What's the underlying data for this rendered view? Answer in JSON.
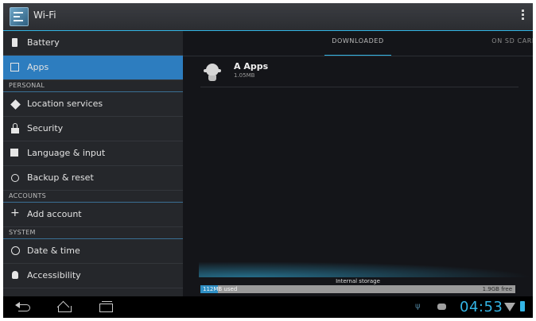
{
  "action_bar": {
    "title": "Wi-Fi"
  },
  "sidebar": {
    "items": [
      {
        "type": "item",
        "label": "Battery",
        "icon": "battery-icon",
        "selected": false
      },
      {
        "type": "item",
        "label": "Apps",
        "icon": "apps-icon",
        "selected": true
      },
      {
        "type": "header",
        "label": "PERSONAL"
      },
      {
        "type": "item",
        "label": "Location services",
        "icon": "location-icon",
        "selected": false
      },
      {
        "type": "item",
        "label": "Security",
        "icon": "lock-icon",
        "selected": false
      },
      {
        "type": "item",
        "label": "Language & input",
        "icon": "language-icon",
        "selected": false
      },
      {
        "type": "item",
        "label": "Backup & reset",
        "icon": "backup-icon",
        "selected": false
      },
      {
        "type": "header",
        "label": "ACCOUNTS"
      },
      {
        "type": "item",
        "label": "Add account",
        "icon": "plus-icon",
        "selected": false
      },
      {
        "type": "header",
        "label": "SYSTEM"
      },
      {
        "type": "item",
        "label": "Date & time",
        "icon": "clock-icon",
        "selected": false
      },
      {
        "type": "item",
        "label": "Accessibility",
        "icon": "accessibility-icon",
        "selected": false
      }
    ]
  },
  "tabs": {
    "downloaded": "DOWNLOADED",
    "sd_card": "ON SD CARD"
  },
  "app_list": [
    {
      "name": "A Apps",
      "size": "1.05MB",
      "icon": "android-icon"
    }
  ],
  "storage": {
    "label": "Internal storage",
    "used": "112MB used",
    "free": "1.9GB free",
    "used_fraction": 0.055
  },
  "system_bar": {
    "time": "04:53"
  },
  "colors": {
    "accent": "#33b5e5",
    "selected": "#2d7dbf",
    "background": "#141519",
    "panel": "#25272b"
  }
}
